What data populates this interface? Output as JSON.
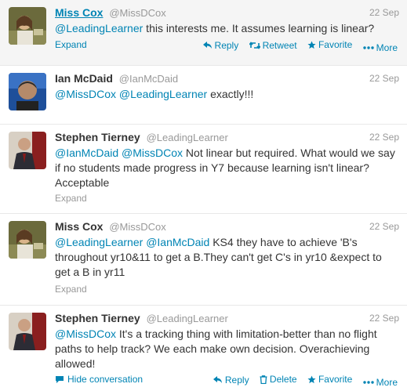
{
  "colors": {
    "link": "#0084b4",
    "meta": "#999999",
    "text": "#333333",
    "hover_bg": "#f5f5f5"
  },
  "tweets": [
    {
      "name": "Miss Cox",
      "handle": "@MissDCox",
      "time": "22 Sep",
      "mention1": "@LeadingLearner",
      "text1": " this interests me. It assumes learning is linear?",
      "expand": "Expand",
      "reply": "Reply",
      "retweet": "Retweet",
      "favorite": "Favorite",
      "more": "More"
    },
    {
      "name": "Ian McDaid",
      "handle": "@IanMcDaid",
      "time": "22 Sep",
      "mention1": "@MissDCox",
      "mention2": "@LeadingLearner",
      "text1": " exactly!!!"
    },
    {
      "name": "Stephen Tierney",
      "handle": "@LeadingLearner",
      "time": "22 Sep",
      "mention1": "@IanMcDaid",
      "mention2": "@MissDCox",
      "text1": " Not linear but required. What would we say if no students made progress in Y7 because learning isn't linear? Acceptable",
      "expand": "Expand"
    },
    {
      "name": "Miss Cox",
      "handle": "@MissDCox",
      "time": "22 Sep",
      "mention1": "@LeadingLearner",
      "mention2": "@IanMcDaid",
      "text1": " KS4 they have to achieve 'B's throughout yr10&11 to get a B.They can't get C's in yr10 &expect to get a B in yr11",
      "expand": "Expand"
    },
    {
      "name": "Stephen Tierney",
      "handle": "@LeadingLearner",
      "time": "22 Sep",
      "mention1": "@MissDCox",
      "text1": " It's a tracking thing with limitation-better than no flight paths to help track? We each make own decision. Overachieving allowed!",
      "hide": "Hide conversation",
      "reply": "Reply",
      "delete": "Delete",
      "favorite": "Favorite",
      "more": "More"
    }
  ]
}
